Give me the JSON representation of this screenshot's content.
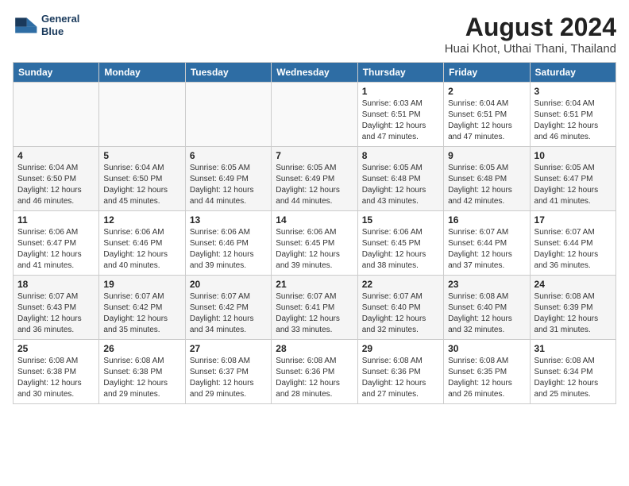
{
  "header": {
    "logo_line1": "General",
    "logo_line2": "Blue",
    "main_title": "August 2024",
    "subtitle": "Huai Khot, Uthai Thani, Thailand"
  },
  "days_of_week": [
    "Sunday",
    "Monday",
    "Tuesday",
    "Wednesday",
    "Thursday",
    "Friday",
    "Saturday"
  ],
  "weeks": [
    [
      {
        "day": "",
        "info": ""
      },
      {
        "day": "",
        "info": ""
      },
      {
        "day": "",
        "info": ""
      },
      {
        "day": "",
        "info": ""
      },
      {
        "day": "1",
        "info": "Sunrise: 6:03 AM\nSunset: 6:51 PM\nDaylight: 12 hours\nand 47 minutes."
      },
      {
        "day": "2",
        "info": "Sunrise: 6:04 AM\nSunset: 6:51 PM\nDaylight: 12 hours\nand 47 minutes."
      },
      {
        "day": "3",
        "info": "Sunrise: 6:04 AM\nSunset: 6:51 PM\nDaylight: 12 hours\nand 46 minutes."
      }
    ],
    [
      {
        "day": "4",
        "info": "Sunrise: 6:04 AM\nSunset: 6:50 PM\nDaylight: 12 hours\nand 46 minutes."
      },
      {
        "day": "5",
        "info": "Sunrise: 6:04 AM\nSunset: 6:50 PM\nDaylight: 12 hours\nand 45 minutes."
      },
      {
        "day": "6",
        "info": "Sunrise: 6:05 AM\nSunset: 6:49 PM\nDaylight: 12 hours\nand 44 minutes."
      },
      {
        "day": "7",
        "info": "Sunrise: 6:05 AM\nSunset: 6:49 PM\nDaylight: 12 hours\nand 44 minutes."
      },
      {
        "day": "8",
        "info": "Sunrise: 6:05 AM\nSunset: 6:48 PM\nDaylight: 12 hours\nand 43 minutes."
      },
      {
        "day": "9",
        "info": "Sunrise: 6:05 AM\nSunset: 6:48 PM\nDaylight: 12 hours\nand 42 minutes."
      },
      {
        "day": "10",
        "info": "Sunrise: 6:05 AM\nSunset: 6:47 PM\nDaylight: 12 hours\nand 41 minutes."
      }
    ],
    [
      {
        "day": "11",
        "info": "Sunrise: 6:06 AM\nSunset: 6:47 PM\nDaylight: 12 hours\nand 41 minutes."
      },
      {
        "day": "12",
        "info": "Sunrise: 6:06 AM\nSunset: 6:46 PM\nDaylight: 12 hours\nand 40 minutes."
      },
      {
        "day": "13",
        "info": "Sunrise: 6:06 AM\nSunset: 6:46 PM\nDaylight: 12 hours\nand 39 minutes."
      },
      {
        "day": "14",
        "info": "Sunrise: 6:06 AM\nSunset: 6:45 PM\nDaylight: 12 hours\nand 39 minutes."
      },
      {
        "day": "15",
        "info": "Sunrise: 6:06 AM\nSunset: 6:45 PM\nDaylight: 12 hours\nand 38 minutes."
      },
      {
        "day": "16",
        "info": "Sunrise: 6:07 AM\nSunset: 6:44 PM\nDaylight: 12 hours\nand 37 minutes."
      },
      {
        "day": "17",
        "info": "Sunrise: 6:07 AM\nSunset: 6:44 PM\nDaylight: 12 hours\nand 36 minutes."
      }
    ],
    [
      {
        "day": "18",
        "info": "Sunrise: 6:07 AM\nSunset: 6:43 PM\nDaylight: 12 hours\nand 36 minutes."
      },
      {
        "day": "19",
        "info": "Sunrise: 6:07 AM\nSunset: 6:42 PM\nDaylight: 12 hours\nand 35 minutes."
      },
      {
        "day": "20",
        "info": "Sunrise: 6:07 AM\nSunset: 6:42 PM\nDaylight: 12 hours\nand 34 minutes."
      },
      {
        "day": "21",
        "info": "Sunrise: 6:07 AM\nSunset: 6:41 PM\nDaylight: 12 hours\nand 33 minutes."
      },
      {
        "day": "22",
        "info": "Sunrise: 6:07 AM\nSunset: 6:40 PM\nDaylight: 12 hours\nand 32 minutes."
      },
      {
        "day": "23",
        "info": "Sunrise: 6:08 AM\nSunset: 6:40 PM\nDaylight: 12 hours\nand 32 minutes."
      },
      {
        "day": "24",
        "info": "Sunrise: 6:08 AM\nSunset: 6:39 PM\nDaylight: 12 hours\nand 31 minutes."
      }
    ],
    [
      {
        "day": "25",
        "info": "Sunrise: 6:08 AM\nSunset: 6:38 PM\nDaylight: 12 hours\nand 30 minutes."
      },
      {
        "day": "26",
        "info": "Sunrise: 6:08 AM\nSunset: 6:38 PM\nDaylight: 12 hours\nand 29 minutes."
      },
      {
        "day": "27",
        "info": "Sunrise: 6:08 AM\nSunset: 6:37 PM\nDaylight: 12 hours\nand 29 minutes."
      },
      {
        "day": "28",
        "info": "Sunrise: 6:08 AM\nSunset: 6:36 PM\nDaylight: 12 hours\nand 28 minutes."
      },
      {
        "day": "29",
        "info": "Sunrise: 6:08 AM\nSunset: 6:36 PM\nDaylight: 12 hours\nand 27 minutes."
      },
      {
        "day": "30",
        "info": "Sunrise: 6:08 AM\nSunset: 6:35 PM\nDaylight: 12 hours\nand 26 minutes."
      },
      {
        "day": "31",
        "info": "Sunrise: 6:08 AM\nSunset: 6:34 PM\nDaylight: 12 hours\nand 25 minutes."
      }
    ]
  ]
}
